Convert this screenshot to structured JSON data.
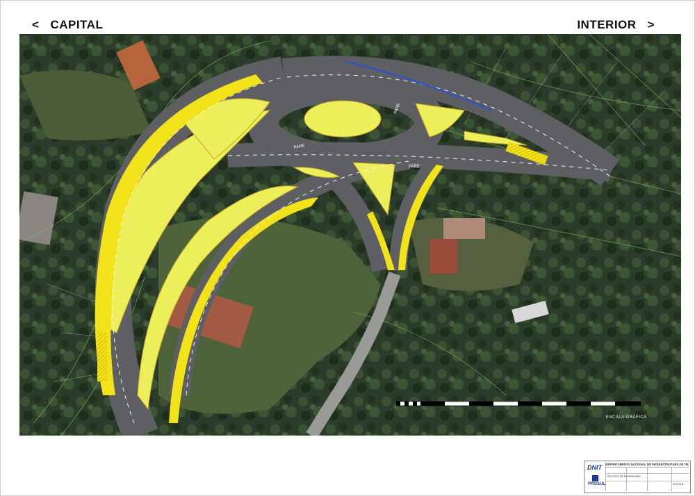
{
  "header": {
    "left": {
      "arrow": "<",
      "label": "CAPITAL"
    },
    "right": {
      "label": "INTERIOR",
      "arrow": ">"
    }
  },
  "map": {
    "road_labels": {
      "pare_1": "PARE",
      "pare_2": "PARE",
      "pare_3": "PARE"
    },
    "scale_label": "ESCALA GRÁFICA"
  },
  "colors": {
    "island_fill": "#ecef5a",
    "edge_fill": "#f2e21a",
    "asphalt": "#5f6063",
    "vegetation": "#2a3c29",
    "grass": "#4d6238"
  },
  "title_block": {
    "org": "DNIT",
    "department": "DEPARTAMENTO NACIONAL DE INFRAESTRUTURA DE TRANSPORTES",
    "company": "PROSUL",
    "project": "PROJETO DE ENGENHARIA",
    "sheet_ref": "FOLHA N°"
  }
}
